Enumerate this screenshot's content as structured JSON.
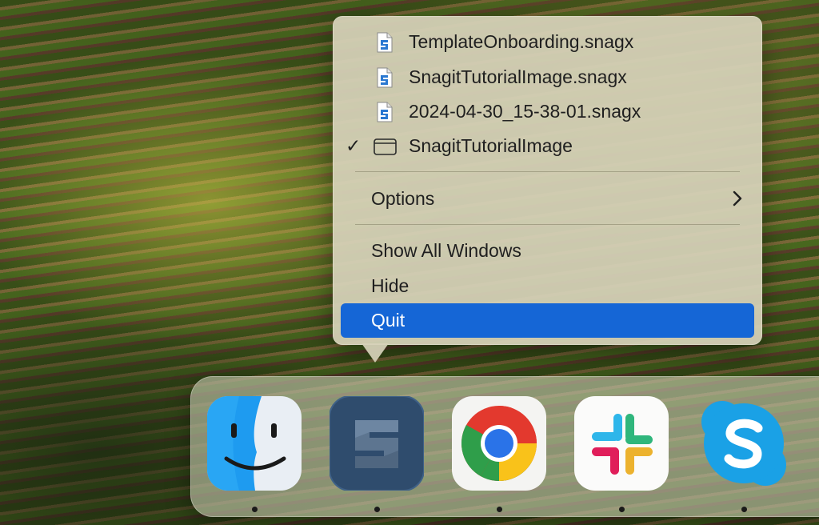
{
  "context_menu": {
    "recent_files": [
      {
        "label": "TemplateOnboarding.snagx",
        "icon": "snagit-file-icon"
      },
      {
        "label": "SnagitTutorialImage.snagx",
        "icon": "snagit-file-icon"
      },
      {
        "label": "2024-04-30_15-38-01.snagx",
        "icon": "snagit-file-icon"
      }
    ],
    "open_window": {
      "label": "SnagitTutorialImage",
      "checkmark": "✓",
      "icon": "window-icon"
    },
    "options": {
      "label": "Options",
      "icon": "chevron-right-icon"
    },
    "show_all_windows": "Show All Windows",
    "hide": "Hide",
    "quit": "Quit",
    "selected_item": "Quit",
    "colors": {
      "selection": "#1566d6",
      "background": "#d6d2b9"
    }
  },
  "dock": {
    "apps": [
      {
        "icon": "finder-icon",
        "running": true
      },
      {
        "icon": "snagit-icon",
        "running": true
      },
      {
        "icon": "chrome-icon",
        "running": true
      },
      {
        "icon": "slack-icon",
        "running": true
      },
      {
        "icon": "skype-icon",
        "running": true
      }
    ]
  }
}
